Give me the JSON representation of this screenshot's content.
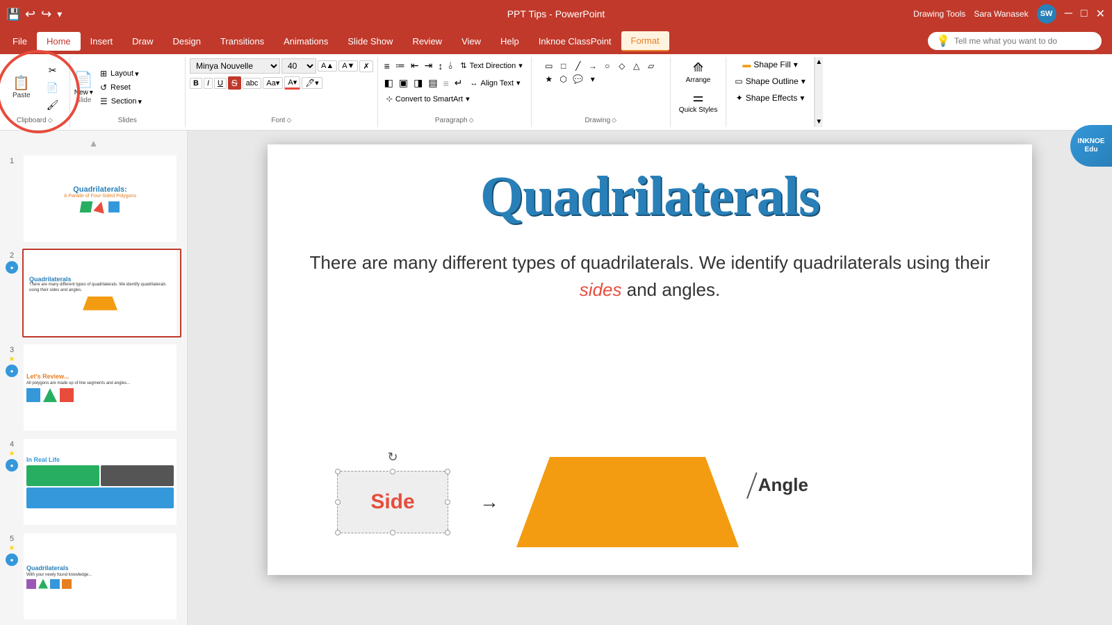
{
  "titlebar": {
    "app_title": "PPT Tips - PowerPoint",
    "tools_label": "Drawing Tools",
    "user_name": "Sara Wanasek",
    "user_initials": "SW"
  },
  "menubar": {
    "items": [
      "File",
      "Home",
      "Insert",
      "Draw",
      "Design",
      "Transitions",
      "Animations",
      "Slide Show",
      "Review",
      "View",
      "Help",
      "Inknoe ClassPoint",
      "Format"
    ],
    "active": "Home",
    "search_placeholder": "Tell me what you want to do",
    "format_label": "Format"
  },
  "ribbon": {
    "clipboard_label": "Clipboard",
    "slides_label": "Slides",
    "font_label": "Font",
    "paragraph_label": "Paragraph",
    "drawing_label": "Drawing",
    "paste_label": "Paste",
    "new_label": "New",
    "slide_label": "Slide",
    "layout_label": "Layout",
    "reset_label": "Reset",
    "section_label": "Section",
    "font_name": "Minya Nouvelle",
    "font_size": "40",
    "bold_label": "B",
    "italic_label": "I",
    "underline_label": "U",
    "strikethrough_label": "S",
    "text_direction_label": "Text Direction",
    "align_text_label": "Align Text",
    "convert_smartart_label": "Convert to SmartArt",
    "arrange_label": "Arrange",
    "quick_styles_label": "Quick Styles",
    "shape_fill_label": "Shape Fill",
    "shape_outline_label": "Shape Outline",
    "shape_effects_label": "Shape Effects"
  },
  "slides": [
    {
      "num": "1",
      "title": "Quadrilaterals:",
      "subtitle": "A Parade of Four-Sided Polygons",
      "active": false
    },
    {
      "num": "2",
      "title": "Quadrilaterals",
      "subtitle": "",
      "active": true
    },
    {
      "num": "3",
      "title": "Let's Review...",
      "subtitle": "",
      "active": false
    },
    {
      "num": "4",
      "title": "In Real Life",
      "subtitle": "",
      "active": false
    },
    {
      "num": "5",
      "title": "Quadrilaterals",
      "subtitle": "",
      "active": false
    }
  ],
  "slide_content": {
    "title": "Quadrilaterals",
    "body": "There are many different types of quadrilaterals. We identify quadrilaterals using their",
    "highlight_word": "sides",
    "body_end": "and angles.",
    "side_label": "Side",
    "angle_label": "Angle"
  },
  "inknoe": {
    "label": "INKNOE\nEdu"
  }
}
